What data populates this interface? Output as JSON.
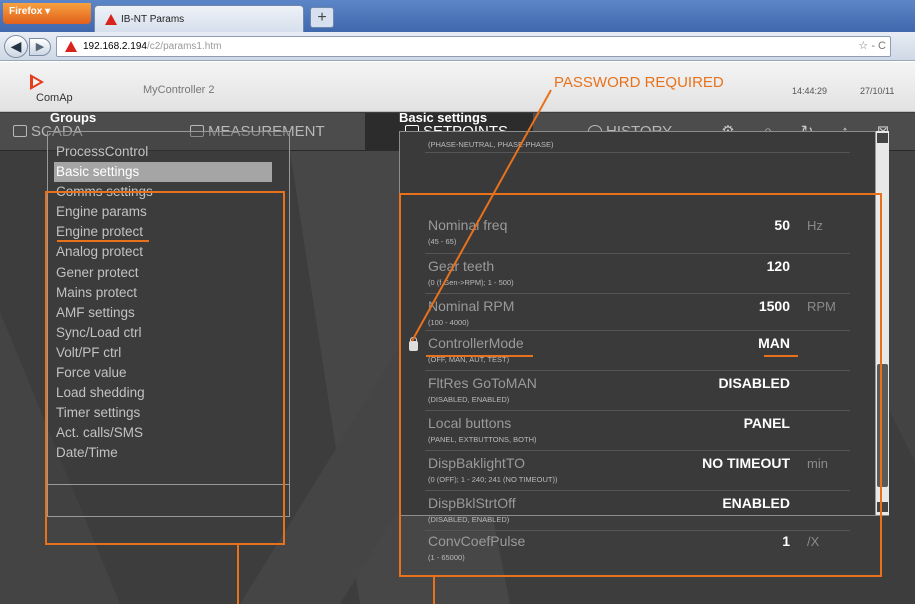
{
  "browser": {
    "app_button": "Firefox",
    "tab_title": "IB-NT Params",
    "new_tab": "+",
    "url_host": "192.168.2.194",
    "url_path": "/c2/params1.htm",
    "url_icons": "☆ - C"
  },
  "header": {
    "logo_text": "ComAp",
    "controller_name": "MyController 2",
    "password_notice": "PASSWORD REQUIRED",
    "time": "14:44:29",
    "date": "27/10/11"
  },
  "menu": {
    "items": [
      {
        "label": "SCADA"
      },
      {
        "label": "MEASUREMENT"
      },
      {
        "label": "SETPOINTS"
      },
      {
        "label": "HISTORY"
      }
    ],
    "toolbar_icons": [
      "gear-icon",
      "lock-icon",
      "refresh-icon",
      "upload-icon",
      "close-icon"
    ]
  },
  "groups": {
    "title": "Groups",
    "items": [
      "ProcessControl",
      "Basic settings",
      "Comms settings",
      "Engine params",
      "Engine protect",
      "Analog protect",
      "Gener protect",
      "Mains protect",
      "AMF settings",
      "Sync/Load ctrl",
      "Volt/PF ctrl",
      "Force value",
      "Load shedding",
      "Timer settings",
      "Act. calls/SMS",
      "Date/Time"
    ],
    "selected": "Basic settings"
  },
  "settings": {
    "title": "Basic settings",
    "top_range": "(PHASE-NEUTRAL, PHASE-PHASE)",
    "rows": [
      {
        "name": "Nominal freq",
        "range": "(45 - 65)",
        "value": "50",
        "unit": "Hz"
      },
      {
        "name": "Gear teeth",
        "range": "(0 (f Gen->RPM); 1 - 500)",
        "value": "120",
        "unit": ""
      },
      {
        "name": "Nominal RPM",
        "range": "(100 - 4000)",
        "value": "1500",
        "unit": "RPM"
      },
      {
        "name": "ControllerMode",
        "range": "(OFF, MAN, AUT, TEST)",
        "value": "MAN",
        "unit": ""
      },
      {
        "name": "FltRes GoToMAN",
        "range": "(DISABLED, ENABLED)",
        "value": "DISABLED",
        "unit": ""
      },
      {
        "name": "Local buttons",
        "range": "(PANEL, EXTBUTTONS, BOTH)",
        "value": "PANEL",
        "unit": ""
      },
      {
        "name": "DispBaklightTO",
        "range": "(0 (OFF); 1 - 240; 241 (NO TIMEOUT))",
        "value": "NO TIMEOUT",
        "unit": "min"
      },
      {
        "name": "DispBklStrtOff",
        "range": "(DISABLED, ENABLED)",
        "value": "ENABLED",
        "unit": ""
      },
      {
        "name": "ConvCoefPulse",
        "range": "(1 - 65000)",
        "value": "1",
        "unit": "/X"
      }
    ]
  },
  "colors": {
    "annotation": "#e8721c",
    "app_background": "#3d3d3d",
    "logo": "#e63c1f"
  }
}
